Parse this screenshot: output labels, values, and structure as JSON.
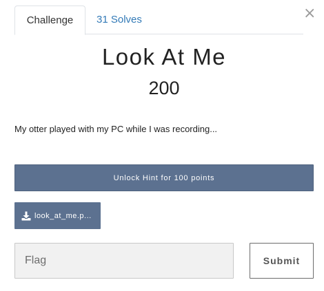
{
  "modal": {
    "close_symbol": "×"
  },
  "tabs": {
    "challenge_label": "Challenge",
    "solves_label": "31 Solves"
  },
  "challenge": {
    "name": "Look At Me",
    "value": "200",
    "description": "My otter played with my PC while I was recording..."
  },
  "hint": {
    "button_label": "Unlock Hint for 100 points"
  },
  "file": {
    "icon": "download-icon",
    "label": "look_at_me.p..."
  },
  "submission": {
    "flag_placeholder": "Flag",
    "submit_label": "Submit"
  },
  "colors": {
    "accent": "#5c7190",
    "link": "#337ab7"
  }
}
